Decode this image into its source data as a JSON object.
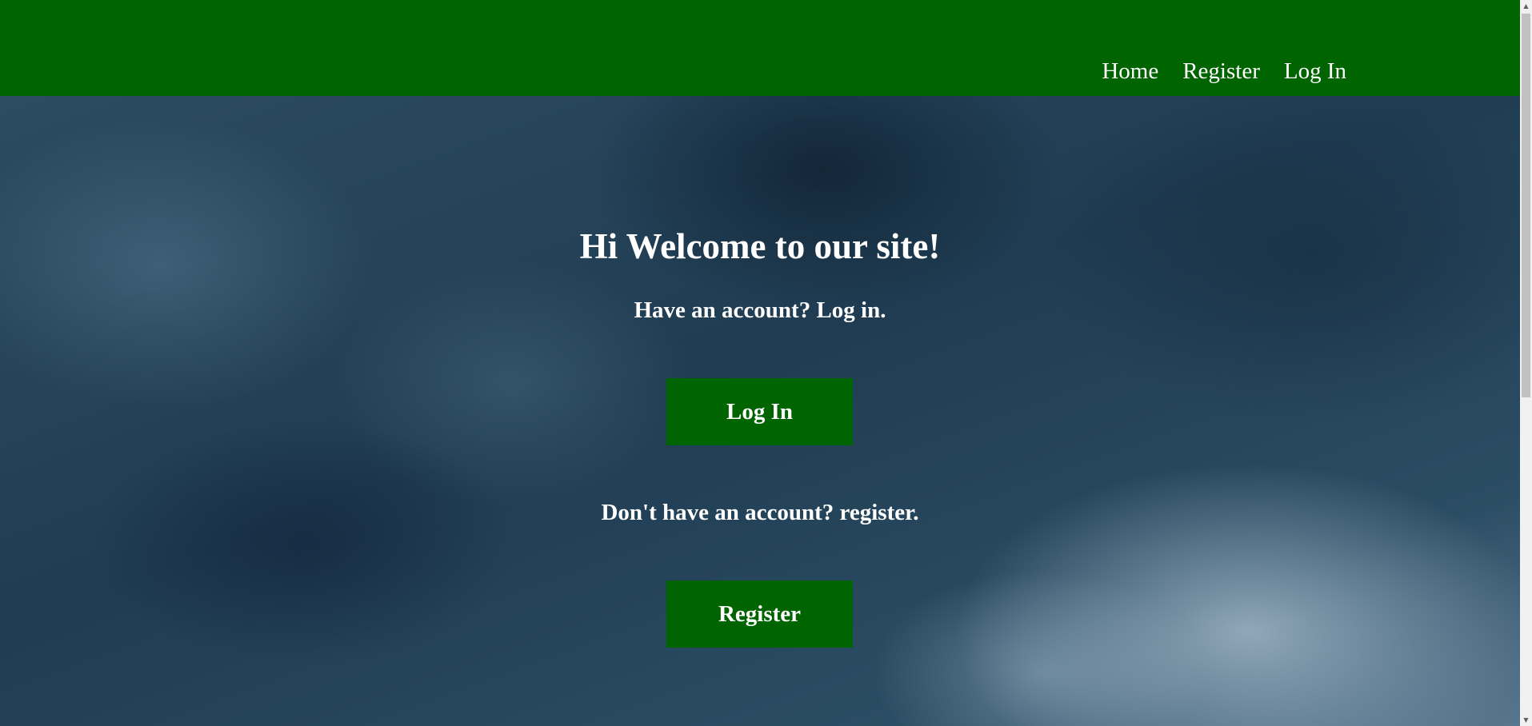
{
  "nav": {
    "links": [
      {
        "label": "Home"
      },
      {
        "label": "Register"
      },
      {
        "label": "Log In"
      }
    ]
  },
  "main": {
    "title": "Hi Welcome to our site!",
    "login_prompt": "Have an account? Log in.",
    "login_button": "Log In",
    "register_prompt": "Don't have an account? register.",
    "register_button": "Register"
  },
  "scrollbar": {
    "up_icon": "▲",
    "down_icon": "▼"
  },
  "colors": {
    "navbar": "#006400",
    "button": "#006400",
    "text": "#ffffff"
  }
}
